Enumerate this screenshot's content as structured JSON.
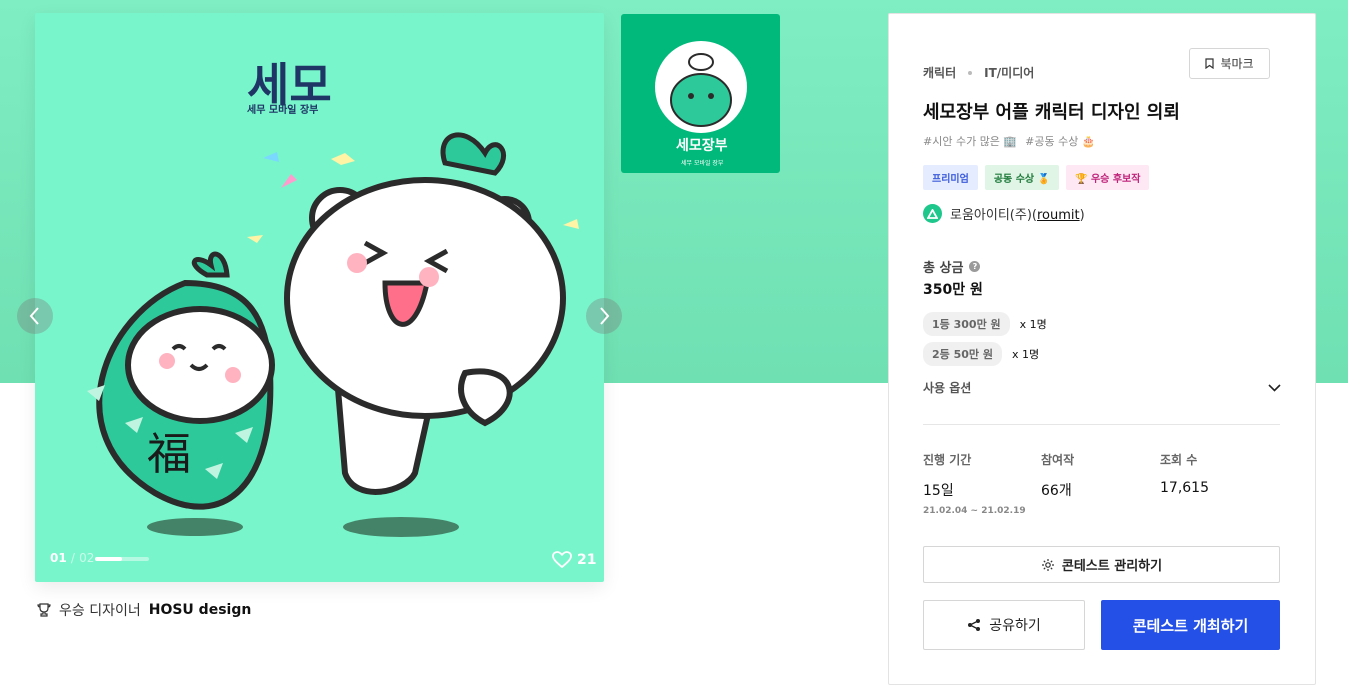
{
  "gallery": {
    "logo_text": "세모",
    "logo_sub": "세무 모바일 장부",
    "thumb_logo": "세모장부",
    "thumb_sub": "세무 모바일 장부",
    "fortune_char": "福",
    "counter_current": "01",
    "counter_sep": "/",
    "counter_total": "02",
    "progress_fraction": 0.5,
    "likes": "21",
    "prev_icon": "chevron-left-icon",
    "next_icon": "chevron-right-icon"
  },
  "designer": {
    "label": "우승 디자이너",
    "name": "HOSU design",
    "icon": "trophy-icon"
  },
  "detail": {
    "category": "캐릭터",
    "subcategory": "IT/미디어",
    "bookmark_label": "북마크",
    "title": "세모장부 어플 캐릭터 디자인 의뢰",
    "hashtags": [
      "#시안 수가 많은 🏢",
      "#공동 수상 🎂"
    ],
    "badges": [
      "프리미엄",
      "공동 수상 🏅",
      "🏆 우승 후보작"
    ],
    "host_name": "로움아이티(주)",
    "host_paren_open": "(",
    "host_handle": "roumit",
    "host_paren_close": ")",
    "prize_label": "총 상금",
    "prize_help": "?",
    "prize_total": "350만 원",
    "prizes": [
      {
        "rank": "1등 300만 원",
        "count": "x 1명"
      },
      {
        "rank": "2등 50만 원",
        "count": "x 1명"
      }
    ],
    "usage_label": "사용 옵션",
    "stats": {
      "period_label": "진행 기간",
      "period_value": "15일",
      "period_dates": "21.02.04 ~ 21.02.19",
      "entries_label": "참여작",
      "entries_value": "66개",
      "views_label": "조회 수",
      "views_value": "17,615"
    },
    "manage_label": "콘테스트 관리하기",
    "share_label": "공유하기",
    "host_contest_label": "콘테스트 개최하기"
  },
  "colors": {
    "band": "#7feec3",
    "image_bg": "#78f5cb",
    "thumb_bg": "#00b97a",
    "primary": "#2450e8",
    "navy": "#1f3566"
  }
}
